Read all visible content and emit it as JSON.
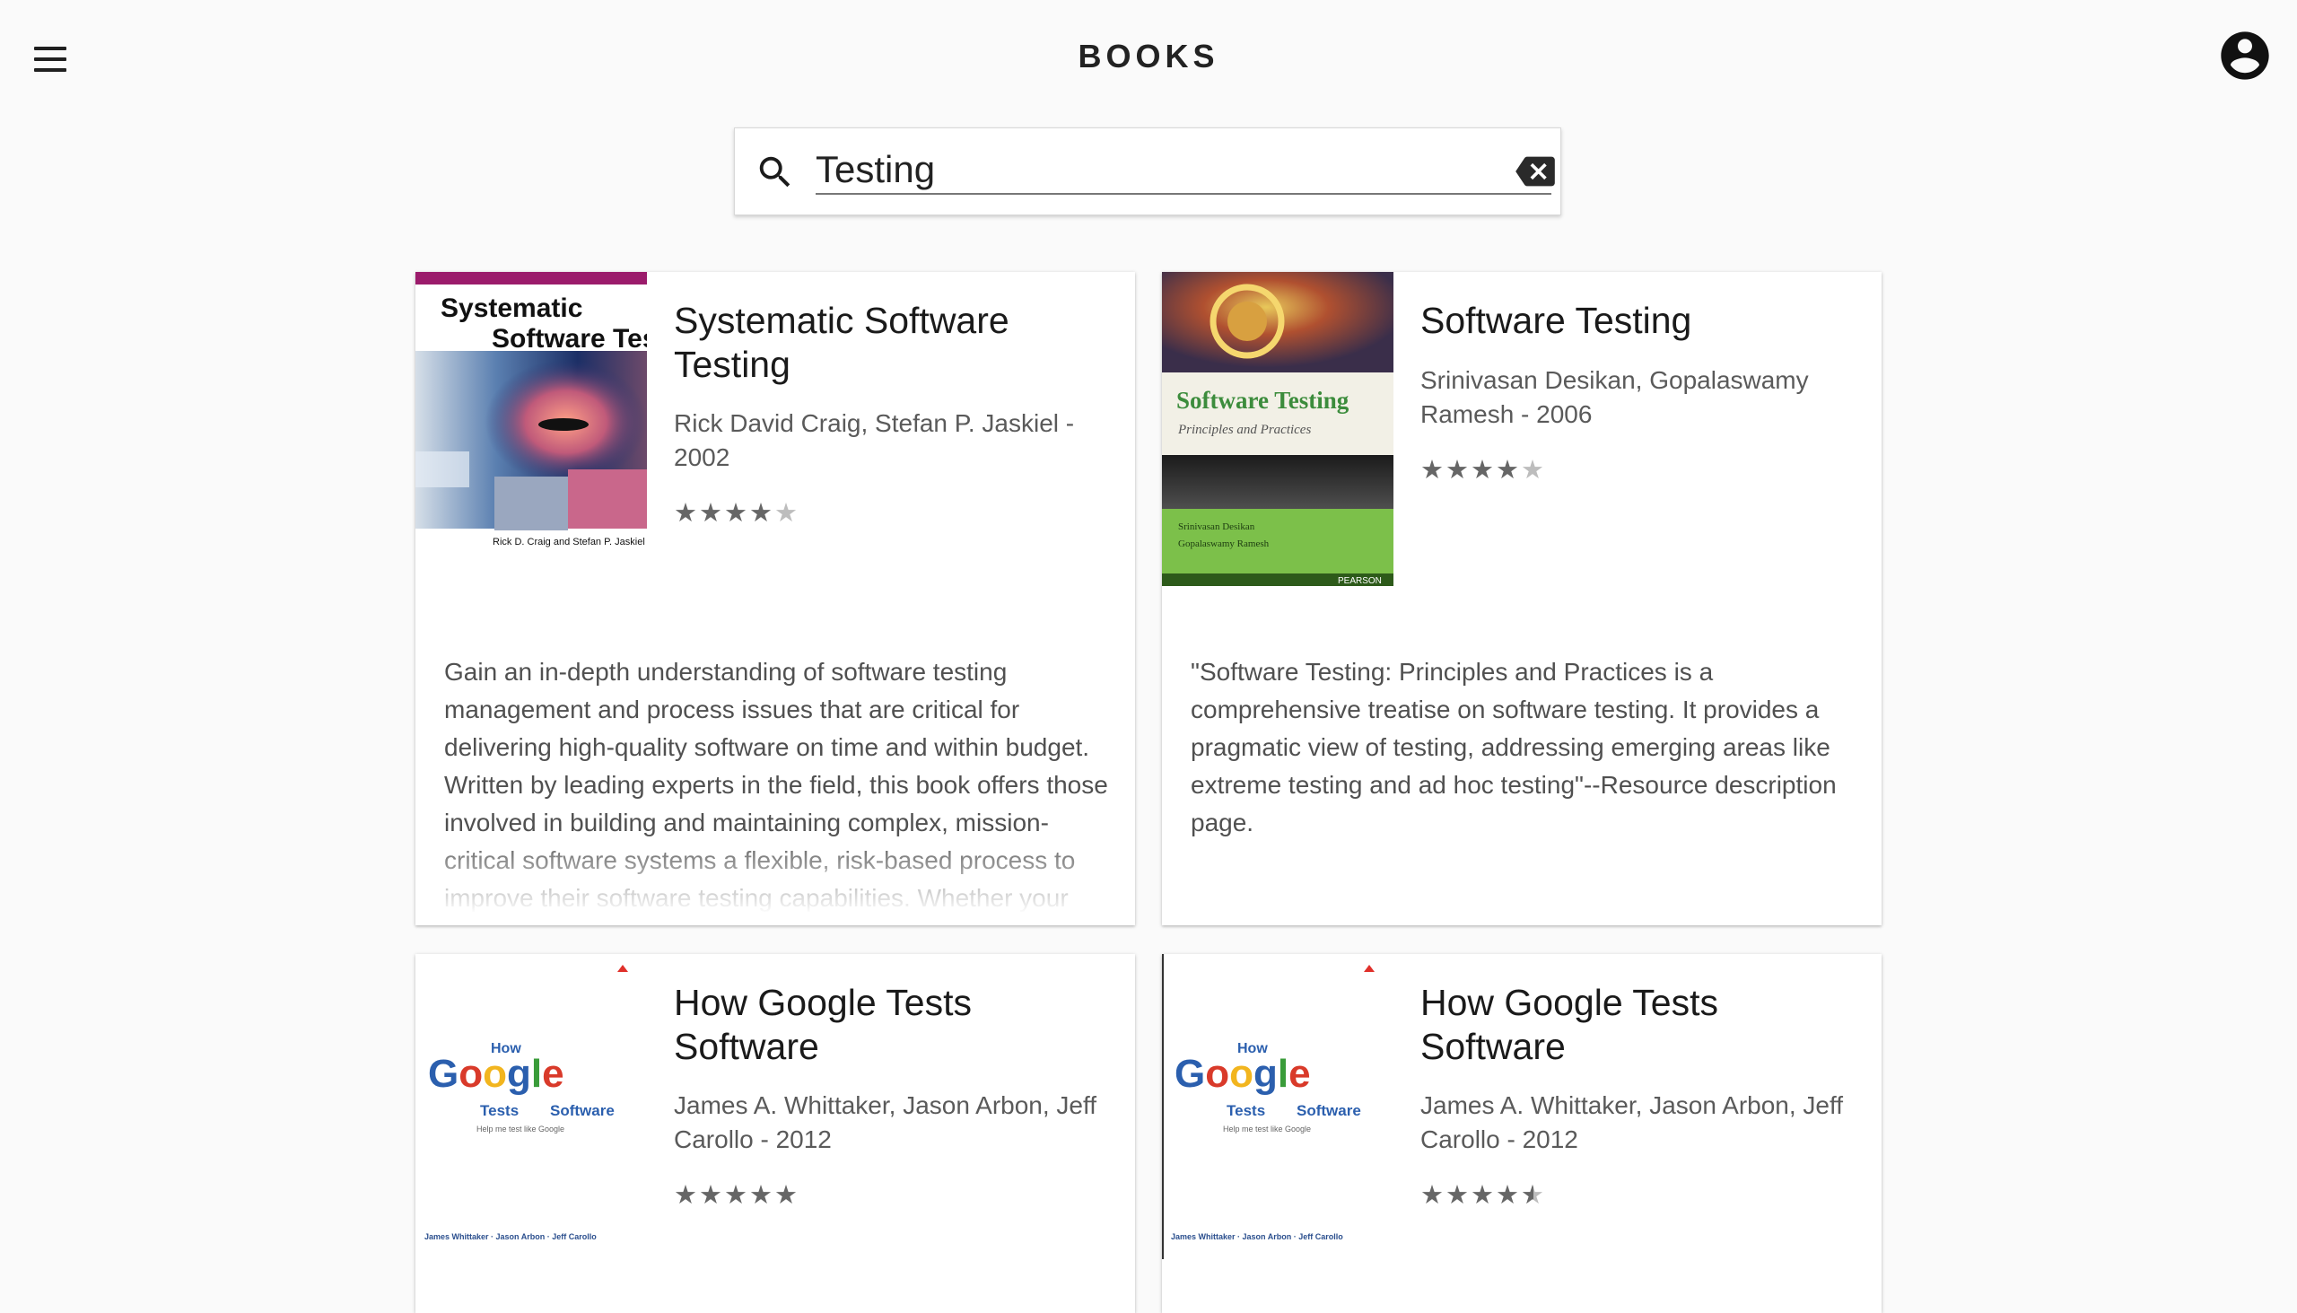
{
  "header": {
    "title": "BOOKS"
  },
  "search": {
    "value": "Testing"
  },
  "books": [
    {
      "title": "Systematic Software Testing",
      "authors_year": "Rick David Craig, Stefan P. Jaskiel - 2002",
      "rating": 4,
      "description": "Gain an in-depth understanding of software testing management and process issues that are critical for delivering high-quality software on time and within budget. Written by leading experts in the field, this book offers those involved in building and maintaining complex, mission-critical software systems a flexible, risk-based process to improve their software testing capabilities. Whether your",
      "cover": {
        "line1": "Systematic",
        "line2": "Software Testing",
        "authors": "Rick D. Craig and Stefan P. Jaskiel"
      }
    },
    {
      "title": "Software Testing",
      "authors_year": "Srinivasan Desikan, Gopalaswamy Ramesh - 2006",
      "rating": 4,
      "description": "\"Software Testing: Principles and Practices is a comprehensive treatise on software testing. It provides a pragmatic view of testing, addressing emerging areas like extreme testing and ad hoc testing\"--Resource description page.",
      "cover": {
        "title": "Software Testing",
        "subtitle": "Principles and Practices",
        "author1": "Srinivasan Desikan",
        "author2": "Gopalaswamy Ramesh",
        "publisher": "PEARSON"
      }
    },
    {
      "title": "How Google Tests Software",
      "authors_year": "James A. Whittaker, Jason Arbon, Jeff Carollo - 2012",
      "rating": 5,
      "cover": {
        "how": "How",
        "word": "Google",
        "tests": "Tests",
        "software": "Software",
        "tagline": "Help me test like Google",
        "authors": "James Whittaker · Jason Arbon · Jeff Carollo"
      }
    },
    {
      "title": "How Google Tests Software",
      "authors_year": "James A. Whittaker, Jason Arbon, Jeff Carollo - 2012",
      "rating": 4.5,
      "cover": {
        "how": "How",
        "word": "Google",
        "tests": "Tests",
        "software": "Software",
        "tagline": "Help me test like Google",
        "authors": "James Whittaker · Jason Arbon · Jeff Carollo"
      }
    }
  ],
  "icons": {
    "menu": "menu-icon",
    "account": "account-circle-icon",
    "search": "search-icon",
    "clear": "backspace-icon",
    "star": "star-icon",
    "star_half": "star-half-icon"
  },
  "colors": {
    "background": "#fafafa",
    "card": "#ffffff",
    "star": "#666666",
    "star_empty": "#bdbdbd"
  }
}
